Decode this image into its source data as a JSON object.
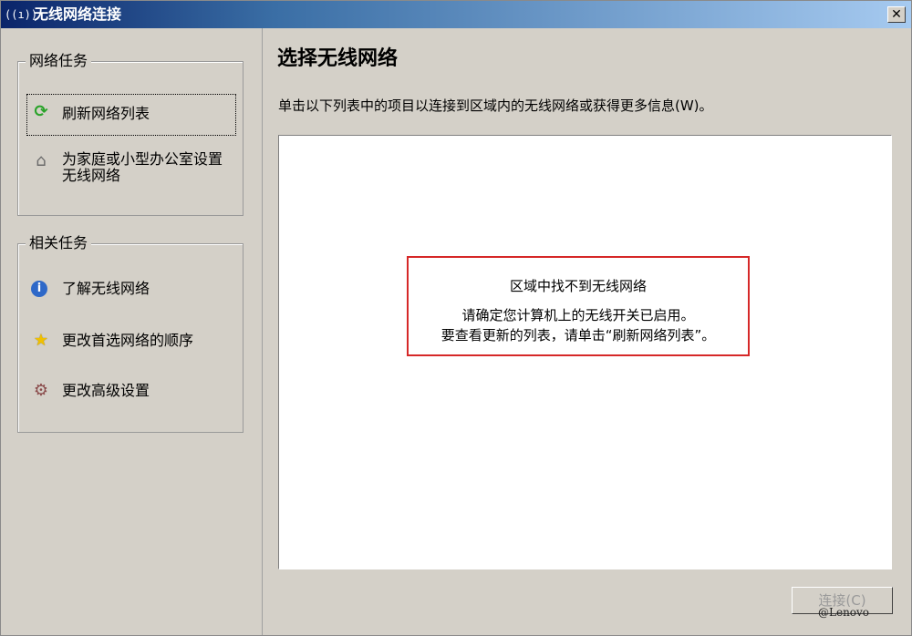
{
  "window": {
    "title": "无线网络连接",
    "title_icon": "((ı))",
    "close_label": "✕"
  },
  "left_pane": {
    "network_tasks": {
      "title": "网络任务",
      "items": [
        {
          "icon": "refresh-icon",
          "label": "刷新网络列表"
        },
        {
          "icon": "router-icon",
          "label": "为家庭或小型办公室设置无线网络"
        }
      ]
    },
    "related_tasks": {
      "title": "相关任务",
      "items": [
        {
          "icon": "info-icon",
          "label": "了解无线网络"
        },
        {
          "icon": "star-icon",
          "label": "更改首选网络的顺序"
        },
        {
          "icon": "gear-icon",
          "label": "更改高级设置"
        }
      ]
    }
  },
  "main": {
    "title": "选择无线网络",
    "instructions": "单击以下列表中的项目以连接到区域内的无线网络或获得更多信息(W)。",
    "message": {
      "line1": "区域中找不到无线网络",
      "line2": "请确定您计算机上的无线开关已启用。",
      "line3": "要查看更新的列表，请单击“刷新网络列表”。"
    },
    "connect_button": "连接(C)"
  },
  "watermark": "@Lenovo",
  "colors": {
    "title_bar_start": "#0a246a",
    "window_bg": "#d4d0c8",
    "highlight_border": "#d62828"
  }
}
